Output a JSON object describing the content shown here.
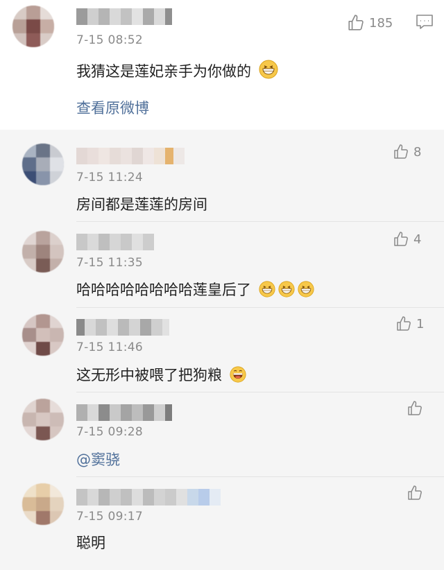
{
  "main_comment": {
    "timestamp": "7-15 08:52",
    "text": "我猜这是莲妃亲手为你做的",
    "likes": "185",
    "view_original": "查看原微博",
    "emojis": [
      "grin-emoji"
    ]
  },
  "replies": [
    {
      "timestamp": "7-15 11:24",
      "text": "房间都是莲莲的房间",
      "likes": "8",
      "emojis": []
    },
    {
      "timestamp": "7-15 11:35",
      "text": "哈哈哈哈哈哈哈哈莲皇后了",
      "likes": "4",
      "emojis": [
        "grin-emoji",
        "grin-emoji",
        "grin-emoji"
      ]
    },
    {
      "timestamp": "7-15 11:46",
      "text": "这无形中被喂了把狗粮",
      "likes": "1",
      "emojis": [
        "laugh-emoji"
      ]
    },
    {
      "timestamp": "7-15 09:28",
      "text": "@窦骁",
      "likes": "",
      "emojis": []
    },
    {
      "timestamp": "7-15 09:17",
      "text": "聪明",
      "likes": "",
      "emojis": []
    }
  ],
  "colors": {
    "link": "#50709a",
    "muted": "#8a8a8a",
    "reply_bg": "#f5f5f5"
  }
}
